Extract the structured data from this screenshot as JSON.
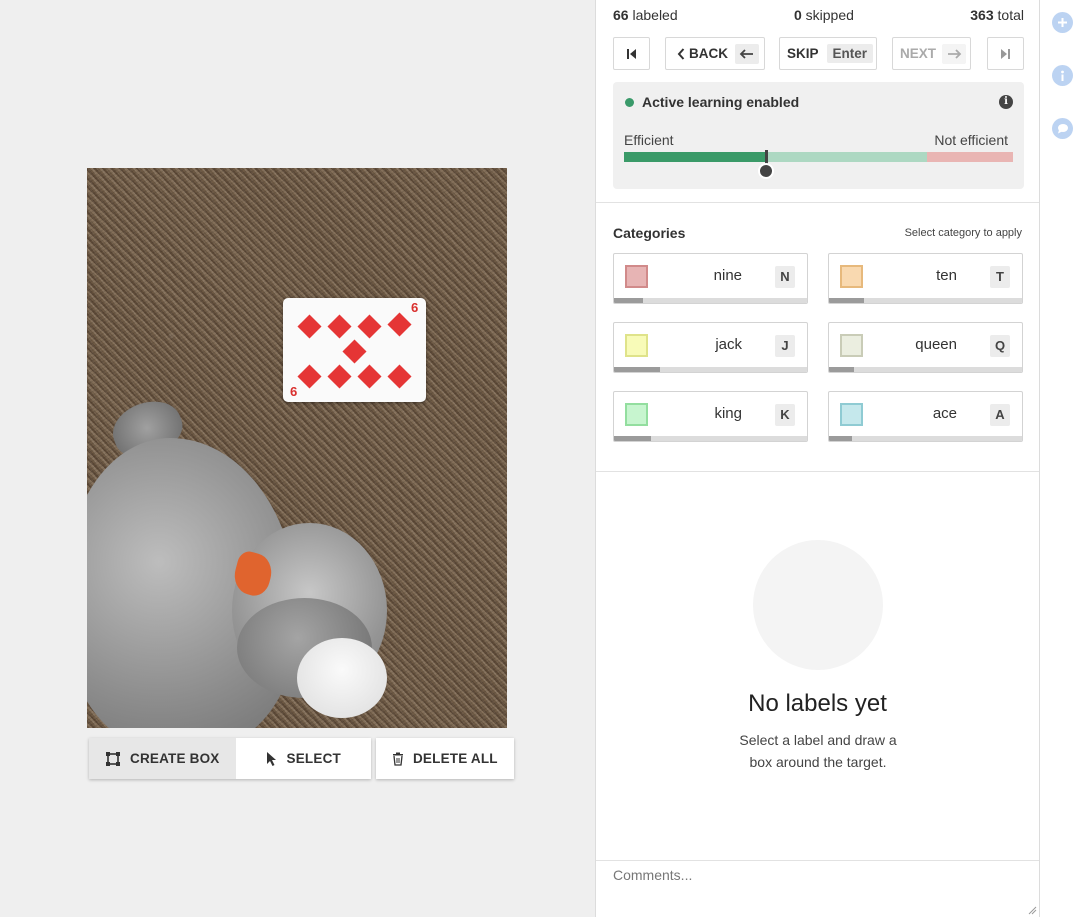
{
  "counts": {
    "labeled_num": "66",
    "labeled_text": "labeled",
    "skipped_num": "0",
    "skipped_text": "skipped",
    "total_num": "363",
    "total_text": "total"
  },
  "nav": {
    "back_label": "BACK",
    "skip_label": "SKIP",
    "skip_key": "Enter",
    "next_label": "NEXT"
  },
  "active_learning": {
    "title": "Active learning enabled",
    "info": "i",
    "left_label": "Efficient",
    "right_label": "Not efficient",
    "colors": {
      "dot": "#3a9a6a",
      "efficient": "#3a9a68",
      "mid": "#add8c2",
      "inefficient": "#e9b5b3"
    }
  },
  "categories": {
    "title": "Categories",
    "hint": "Select category to apply",
    "items": [
      {
        "name": "nine",
        "key": "N",
        "color": "#e7b4b4",
        "border": "#d18a8a",
        "progress": 0.15
      },
      {
        "name": "ten",
        "key": "T",
        "color": "#f9d9b0",
        "border": "#e7b97c",
        "progress": 0.18
      },
      {
        "name": "jack",
        "key": "J",
        "color": "#f8fbb8",
        "border": "#dfe38a",
        "progress": 0.24
      },
      {
        "name": "queen",
        "key": "Q",
        "color": "#ebeee0",
        "border": "#c9ccb7",
        "progress": 0.13
      },
      {
        "name": "king",
        "key": "K",
        "color": "#c7f5cf",
        "border": "#93de9f",
        "progress": 0.19
      },
      {
        "name": "ace",
        "key": "A",
        "color": "#c5e8ec",
        "border": "#8fcbd3",
        "progress": 0.12
      }
    ]
  },
  "empty_state": {
    "title": "No labels yet",
    "text": "Select a label and draw a box around the target."
  },
  "comments": {
    "placeholder": "Comments..."
  },
  "toolbar": {
    "create_box": "CREATE BOX",
    "select": "SELECT",
    "delete_all": "DELETE ALL"
  },
  "card": {
    "rank": "9"
  },
  "rail": {
    "icons": [
      "plus-circle-icon",
      "info-circle-icon",
      "chat-bubble-icon"
    ]
  }
}
